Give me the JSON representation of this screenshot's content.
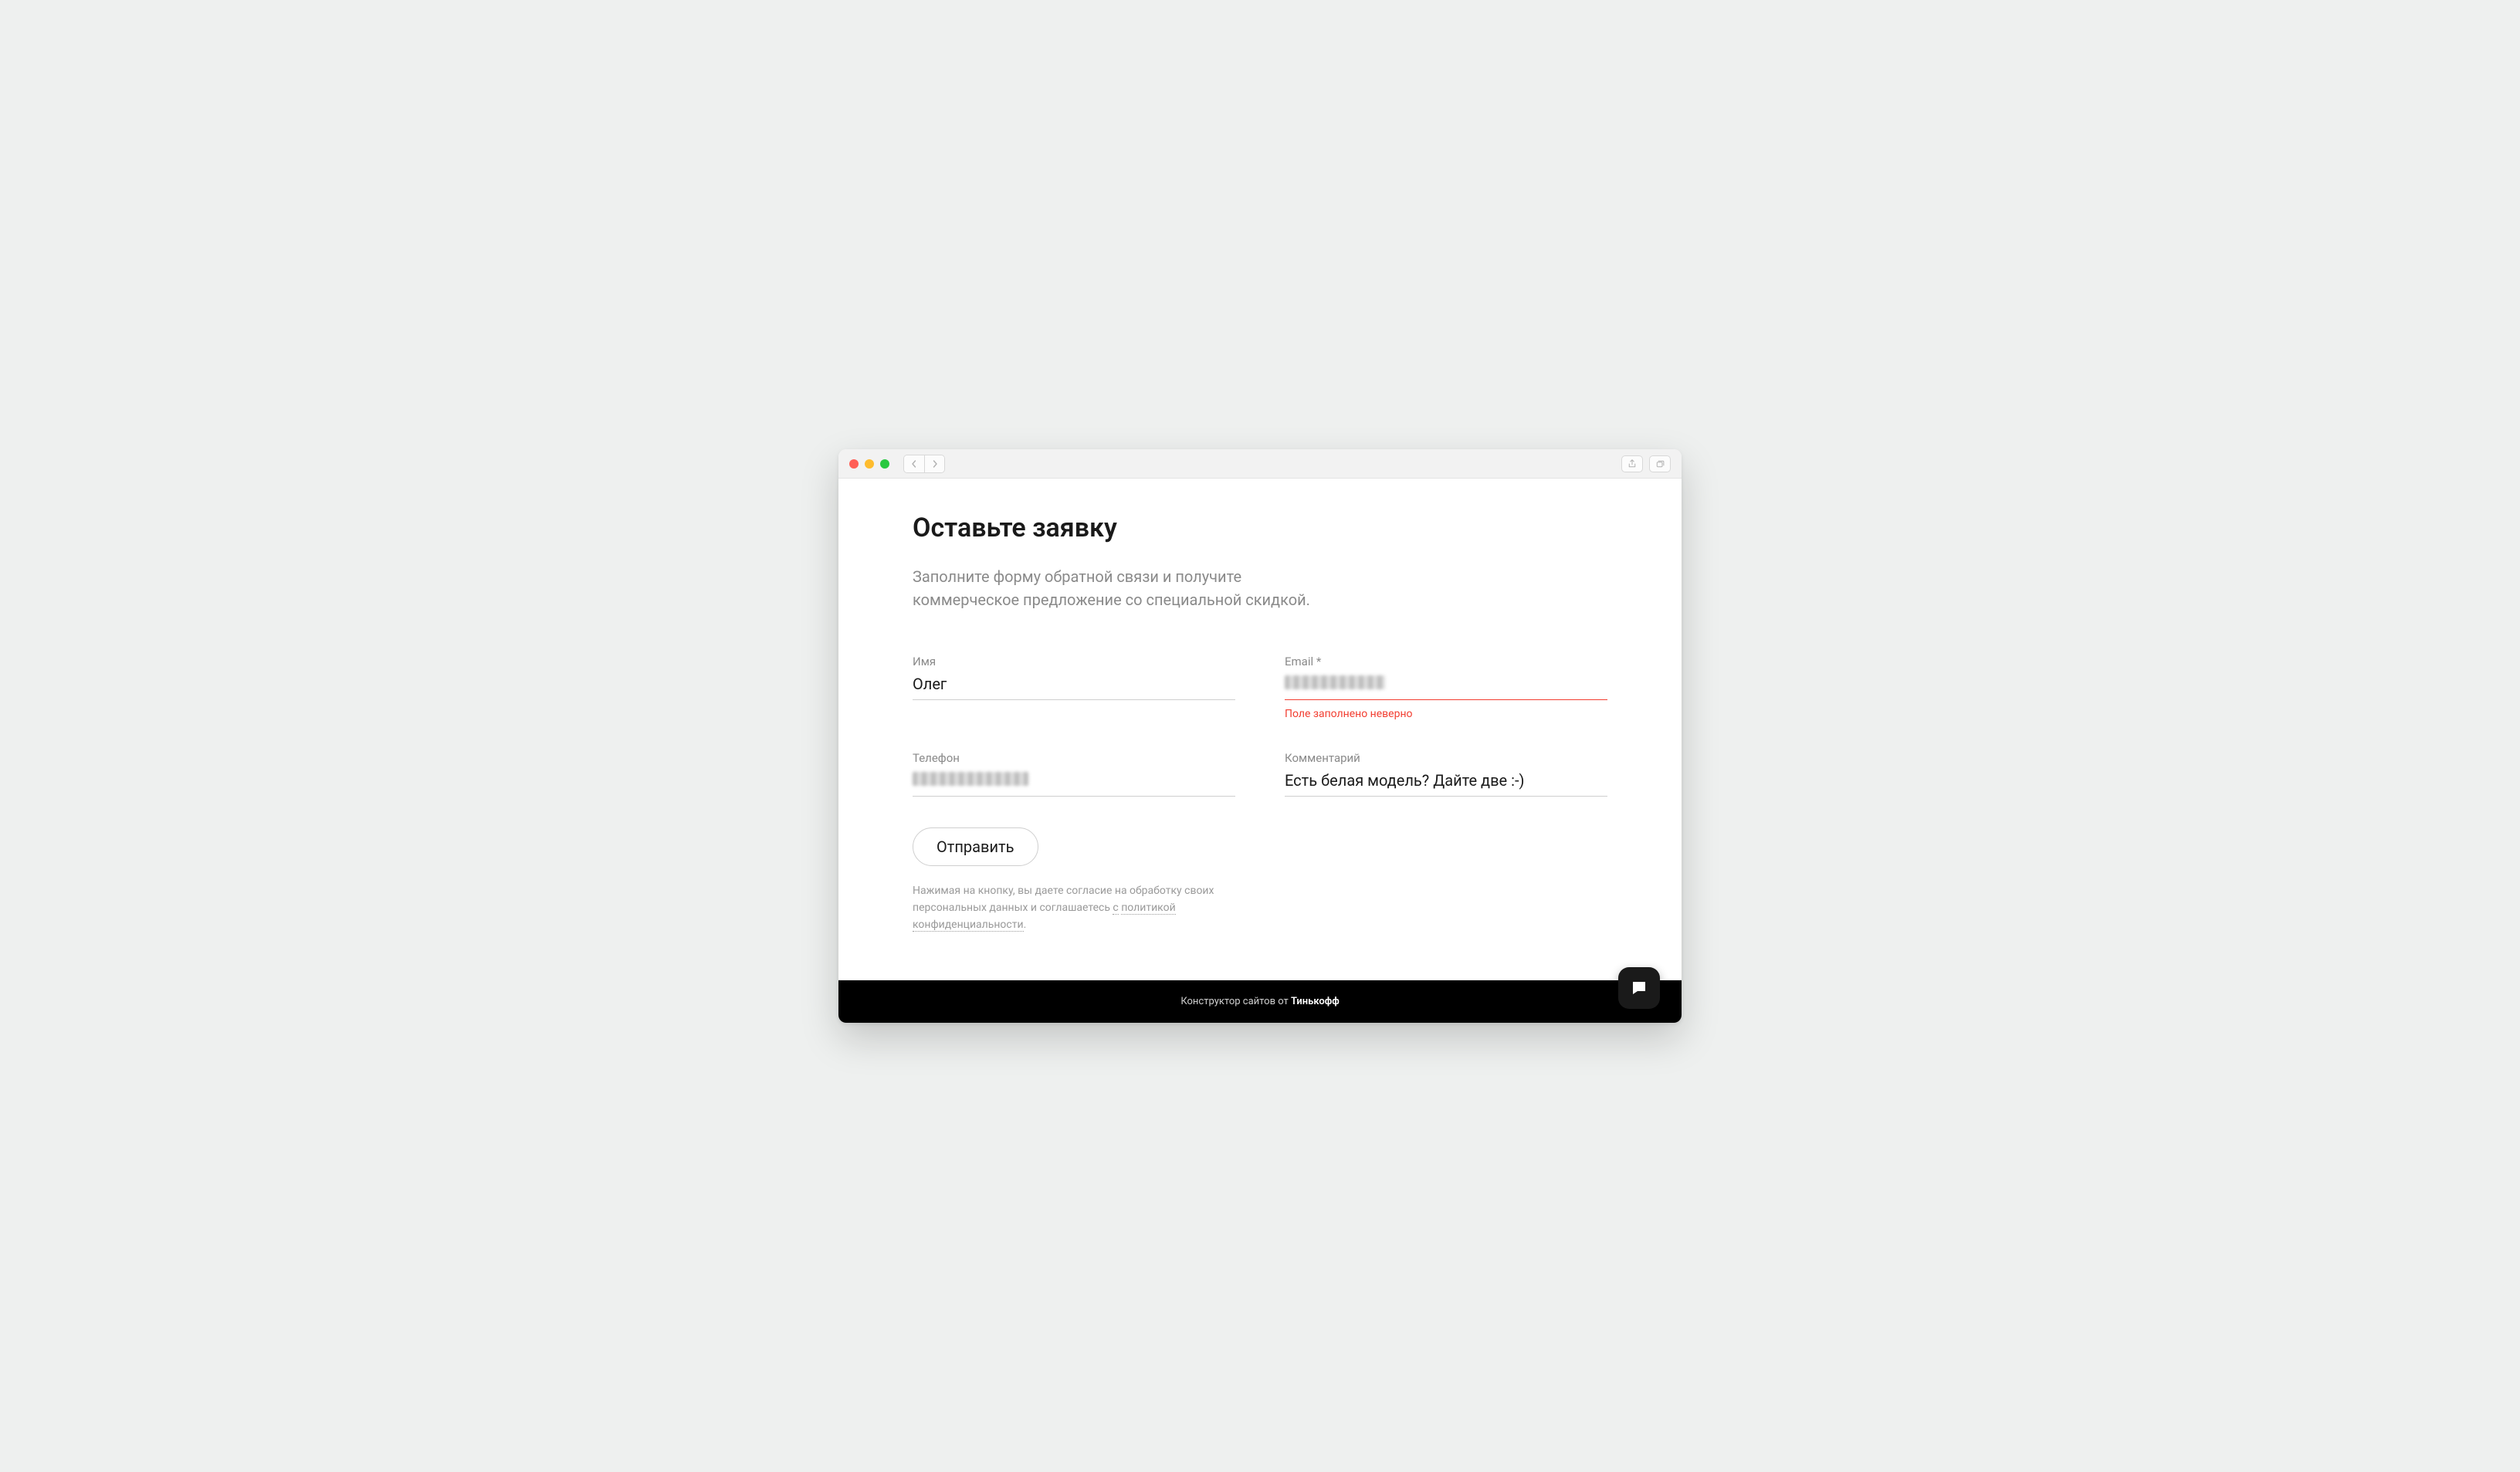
{
  "page": {
    "heading": "Оставьте заявку",
    "subheading": "Заполните форму обратной связи и получите коммерческое предложение со специальной скидкой."
  },
  "form": {
    "name": {
      "label": "Имя",
      "value": "Олег"
    },
    "email": {
      "label": "Email *",
      "value": "",
      "error": "Поле заполнено неверно"
    },
    "phone": {
      "label": "Телефон",
      "value": ""
    },
    "comment": {
      "label": "Комментарий",
      "value": "Есть белая модель? Дайте две :-)"
    },
    "submit_label": "Отправить"
  },
  "consent": {
    "prefix": "Нажимая на кнопку, вы даете согласие на обработку своих персональных данных и соглашаетесь ",
    "link_with": "с",
    "link_policy": "политикой конфиденциальности",
    "suffix": "."
  },
  "footer": {
    "text_prefix": "Конструктор сайтов от ",
    "brand": "Тинькофф"
  }
}
